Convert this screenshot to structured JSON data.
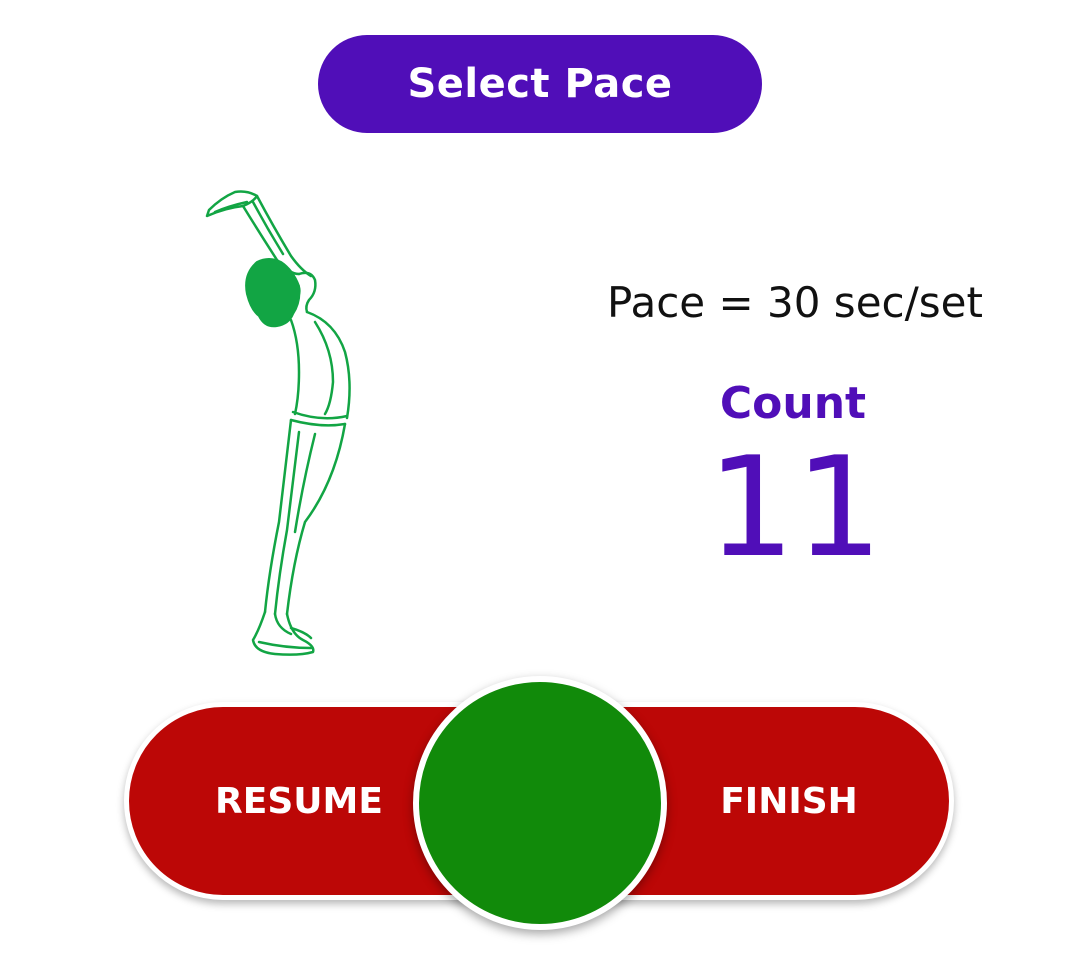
{
  "header": {
    "select_pace_label": "Select Pace"
  },
  "pace": {
    "text": "Pace = 30 sec/set"
  },
  "counter": {
    "label": "Count",
    "value": "11"
  },
  "controls": {
    "resume_label": "RESUME",
    "finish_label": "FINISH"
  },
  "illustration": {
    "icon": "yoga-standing-backbend-pose-icon"
  },
  "colors": {
    "accent_purple": "#500EB8",
    "stop_red": "#BC0706",
    "go_green": "#118A0A",
    "figure_green": "#12A544"
  }
}
